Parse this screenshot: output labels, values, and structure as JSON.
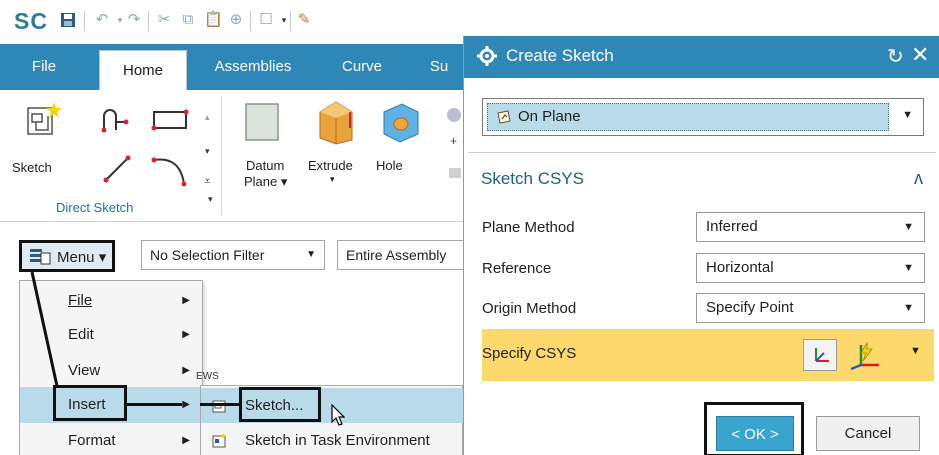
{
  "app": {
    "logo": "SC"
  },
  "tabs": [
    {
      "label": "File",
      "active": false
    },
    {
      "label": "Home",
      "active": true
    },
    {
      "label": "Assemblies",
      "active": false
    },
    {
      "label": "Curve",
      "active": false
    },
    {
      "label": "Su",
      "active": false
    }
  ],
  "ribbon": {
    "sketch_label": "Sketch",
    "group_label": "Direct Sketch",
    "datum_label_1": "Datum",
    "datum_label_2": "Plane ▾",
    "extrude_label": "Extrude",
    "hole_label": "Hole"
  },
  "toolbar": {
    "menu_label": "Menu ▾",
    "selection_filter": "No Selection Filter",
    "scope": "Entire Assembly"
  },
  "menu": {
    "items": [
      {
        "label": "File",
        "has_submenu": true
      },
      {
        "label": "Edit",
        "has_submenu": true
      },
      {
        "label": "View",
        "has_submenu": true
      },
      {
        "label": "Insert",
        "has_submenu": true,
        "highlighted": true
      },
      {
        "label": "Format",
        "has_submenu": true
      }
    ]
  },
  "submenu": {
    "header": "EWS",
    "items": [
      {
        "label": "Sketch...",
        "highlighted": true
      },
      {
        "label": "Sketch in Task Environment",
        "highlighted": false
      }
    ]
  },
  "dialog": {
    "title": "Create Sketch",
    "sketch_type": "On Plane",
    "section_title": "Sketch CSYS",
    "rows": [
      {
        "label": "Plane Method",
        "value": "Inferred"
      },
      {
        "label": "Reference",
        "value": "Horizontal"
      },
      {
        "label": "Origin Method",
        "value": "Specify Point"
      }
    ],
    "specify_csys_label": "Specify CSYS",
    "ok_label": "< OK >",
    "cancel_label": "Cancel"
  },
  "colors": {
    "accent": "#2e87b6",
    "highlight": "#b9dbe9",
    "csys_row": "#fdd96d",
    "ok_button": "#39a5cf"
  }
}
